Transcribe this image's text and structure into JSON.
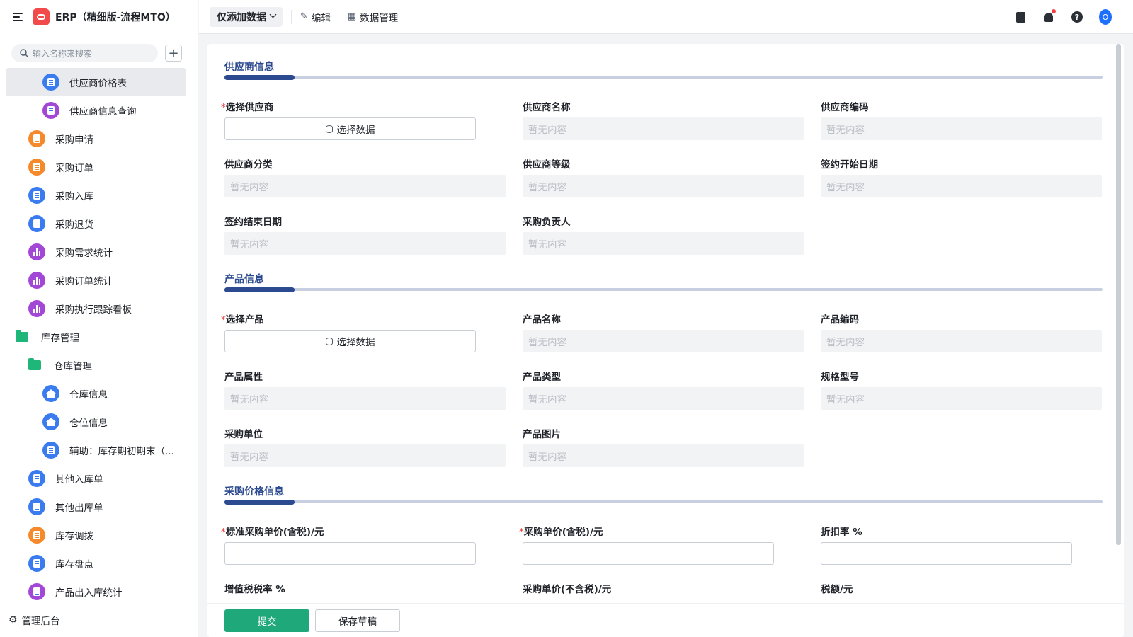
{
  "app": {
    "title": "ERP（精细版-流程MTO）"
  },
  "search": {
    "placeholder": "输入名称来搜索"
  },
  "sidebar": {
    "items": [
      {
        "label": "供应商价格表",
        "icon": "doc",
        "color": "blue",
        "level": "l2",
        "active": true
      },
      {
        "label": "供应商信息查询",
        "icon": "doc",
        "color": "purple",
        "level": "l2"
      },
      {
        "label": "采购申请",
        "icon": "doc",
        "color": "orange",
        "level": "l1"
      },
      {
        "label": "采购订单",
        "icon": "doc",
        "color": "orange",
        "level": "l1"
      },
      {
        "label": "采购入库",
        "icon": "doc",
        "color": "blue",
        "level": "l1"
      },
      {
        "label": "采购退货",
        "icon": "doc",
        "color": "blue",
        "level": "l1"
      },
      {
        "label": "采购需求统计",
        "icon": "bars",
        "color": "purple",
        "level": "l1"
      },
      {
        "label": "采购订单统计",
        "icon": "bars",
        "color": "purple",
        "level": "l1"
      },
      {
        "label": "采购执行跟踪看板",
        "icon": "bars",
        "color": "purple",
        "level": "l1"
      },
      {
        "label": "库存管理",
        "icon": "folder",
        "level": "f0"
      },
      {
        "label": "仓库管理",
        "icon": "folder",
        "level": "f1"
      },
      {
        "label": "仓库信息",
        "icon": "house",
        "color": "blue",
        "level": "l2"
      },
      {
        "label": "仓位信息",
        "icon": "house",
        "color": "blue",
        "level": "l2"
      },
      {
        "label": "辅助：库存期初期末（...",
        "icon": "doc",
        "color": "blue",
        "level": "l2"
      },
      {
        "label": "其他入库单",
        "icon": "doc",
        "color": "blue",
        "level": "l1"
      },
      {
        "label": "其他出库单",
        "icon": "doc",
        "color": "blue",
        "level": "l1"
      },
      {
        "label": "库存调拨",
        "icon": "doc",
        "color": "orange",
        "level": "l1"
      },
      {
        "label": "库存盘点",
        "icon": "doc",
        "color": "blue",
        "level": "l1"
      },
      {
        "label": "产品出入库统计",
        "icon": "doc",
        "color": "purple",
        "level": "l1"
      }
    ],
    "footer_label": "管理后台"
  },
  "toolbar": {
    "view_select": "仅添加数据",
    "edit_label": "编辑",
    "data_manage_label": "数据管理",
    "avatar_letter": "O"
  },
  "form": {
    "empty_text": "暂无内容",
    "select_data_label": "选择数据",
    "sections": [
      {
        "title": "供应商信息"
      },
      {
        "title": "产品信息"
      },
      {
        "title": "采购价格信息"
      }
    ],
    "supplier": {
      "select": "选择供应商",
      "name": "供应商名称",
      "code": "供应商编码",
      "category": "供应商分类",
      "grade": "供应商等级",
      "sign_start": "签约开始日期",
      "sign_end": "签约结束日期",
      "buyer": "采购负责人"
    },
    "product": {
      "select": "选择产品",
      "name": "产品名称",
      "code": "产品编码",
      "attr": "产品属性",
      "type": "产品类型",
      "spec": "规格型号",
      "unit": "采购单位",
      "image": "产品图片"
    },
    "price": {
      "std_price": "标准采购单价(含税)/元",
      "price_tax": "采购单价(含税)/元",
      "discount": "折扣率 %",
      "vat_rate": "增值税税率 %",
      "price_notax": "采购单价(不含税)/元",
      "tax_amount": "税额/元"
    }
  },
  "footer": {
    "submit": "提交",
    "draft": "保存草稿"
  },
  "colors": {
    "accent": "#2c4a8f",
    "submit": "#1fa87a",
    "required": "#f53f3f"
  }
}
